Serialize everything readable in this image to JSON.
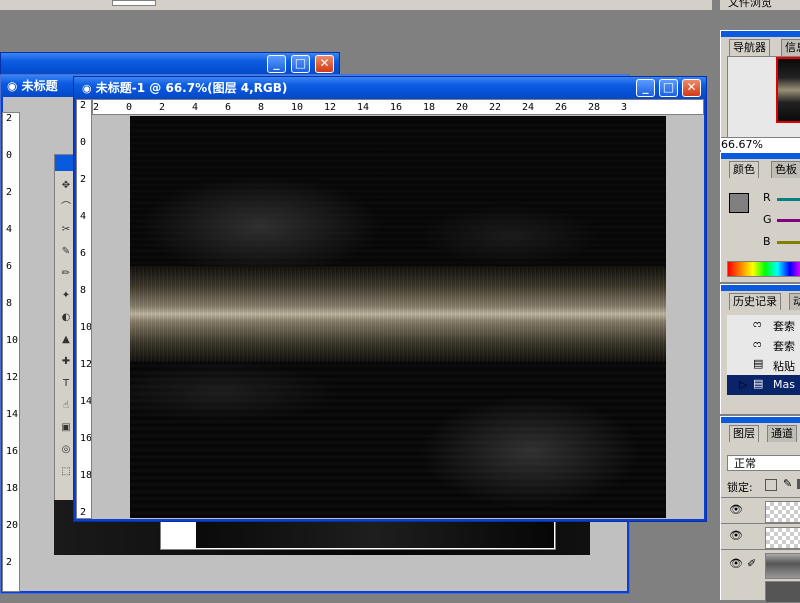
{
  "app_menu": {
    "top_right_text": "文件浏览"
  },
  "back_window": {
    "title": "未标题"
  },
  "main_window": {
    "title": "未标题-1 @ 66.7%(图层 4,RGB)",
    "ruler_top_labels": [
      "2",
      "0",
      "2",
      "4",
      "6",
      "8",
      "10",
      "12",
      "14",
      "16",
      "18",
      "20",
      "22",
      "24",
      "26",
      "28",
      "3"
    ],
    "ruler_left_labels": [
      "2",
      "0",
      "2",
      "4",
      "6",
      "8",
      "10",
      "12",
      "14",
      "16",
      "18",
      "2"
    ]
  },
  "side_ruler_labels": [
    "2",
    "0",
    "2",
    "4",
    "6",
    "8",
    "10",
    "12",
    "14",
    "16",
    "18",
    "20",
    "2"
  ],
  "navigator": {
    "tab_navigator": "导航器",
    "tab_info": "信息",
    "zoom": "66.67%"
  },
  "color_panel": {
    "tab_color": "颜色",
    "tab_swatches": "色板",
    "channels": [
      "R",
      "G",
      "B"
    ],
    "colors": {
      "r": "#008080",
      "g": "#800080",
      "b": "#808000"
    }
  },
  "history": {
    "tab_history": "历史记录",
    "tab_actions": "动",
    "items": [
      "套索",
      "套索",
      "粘贴",
      "Mas"
    ]
  },
  "layers": {
    "tab_layers": "图层",
    "tab_channels": "通道",
    "blend_mode": "正常",
    "lock_label": "锁定:"
  }
}
